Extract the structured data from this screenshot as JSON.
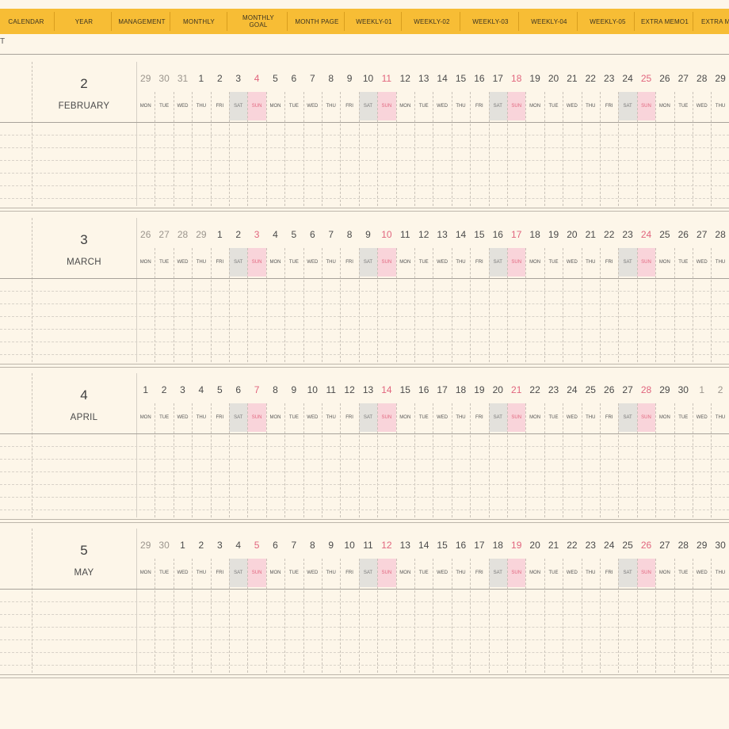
{
  "tabs": [
    {
      "label": "CALENDAR"
    },
    {
      "label": "YEAR"
    },
    {
      "label": "MANAGEMENT"
    },
    {
      "label": "MONTHLY"
    },
    {
      "label": "MONTHLY\nGOAL"
    },
    {
      "label": "MONTH PAGE"
    },
    {
      "label": "WEEKLY-01"
    },
    {
      "label": "WEEKLY-02"
    },
    {
      "label": "WEEKLY-03"
    },
    {
      "label": "WEEKLY-04"
    },
    {
      "label": "WEEKLY-05"
    },
    {
      "label": "EXTRA MEMO1"
    },
    {
      "label": "EXTRA ME"
    }
  ],
  "cut_glyph": "T",
  "colors": {
    "tab_bar": "#f7bd35",
    "background": "#fdf6e9",
    "sunday": "#e1657e",
    "sunday_bg": "#f9d4da",
    "saturday_bg": "#e3e1dc"
  },
  "months": [
    {
      "num": "2",
      "name": "FEBRUARY",
      "days": [
        {
          "n": "29",
          "wd": "MON",
          "t": "other"
        },
        {
          "n": "30",
          "wd": "TUE",
          "t": "other"
        },
        {
          "n": "31",
          "wd": "WED",
          "t": "other"
        },
        {
          "n": "1",
          "wd": "THU"
        },
        {
          "n": "2",
          "wd": "FRI"
        },
        {
          "n": "3",
          "wd": "SAT",
          "t": "sat"
        },
        {
          "n": "4",
          "wd": "SUN",
          "t": "sun"
        },
        {
          "n": "5",
          "wd": "MON"
        },
        {
          "n": "6",
          "wd": "TUE"
        },
        {
          "n": "7",
          "wd": "WED"
        },
        {
          "n": "8",
          "wd": "THU"
        },
        {
          "n": "9",
          "wd": "FRI"
        },
        {
          "n": "10",
          "wd": "SAT",
          "t": "sat"
        },
        {
          "n": "11",
          "wd": "SUN",
          "t": "sun"
        },
        {
          "n": "12",
          "wd": "MON"
        },
        {
          "n": "13",
          "wd": "TUE"
        },
        {
          "n": "14",
          "wd": "WED"
        },
        {
          "n": "15",
          "wd": "THU"
        },
        {
          "n": "16",
          "wd": "FRI"
        },
        {
          "n": "17",
          "wd": "SAT",
          "t": "sat"
        },
        {
          "n": "18",
          "wd": "SUN",
          "t": "sun"
        },
        {
          "n": "19",
          "wd": "MON"
        },
        {
          "n": "20",
          "wd": "TUE"
        },
        {
          "n": "21",
          "wd": "WED"
        },
        {
          "n": "22",
          "wd": "THU"
        },
        {
          "n": "23",
          "wd": "FRI"
        },
        {
          "n": "24",
          "wd": "SAT",
          "t": "sat"
        },
        {
          "n": "25",
          "wd": "SUN",
          "t": "sun"
        },
        {
          "n": "26",
          "wd": "MON"
        },
        {
          "n": "27",
          "wd": "TUE"
        },
        {
          "n": "28",
          "wd": "WED"
        },
        {
          "n": "29",
          "wd": "THU"
        }
      ]
    },
    {
      "num": "3",
      "name": "MARCH",
      "days": [
        {
          "n": "26",
          "wd": "MON",
          "t": "other"
        },
        {
          "n": "27",
          "wd": "TUE",
          "t": "other"
        },
        {
          "n": "28",
          "wd": "WED",
          "t": "other"
        },
        {
          "n": "29",
          "wd": "THU",
          "t": "other"
        },
        {
          "n": "1",
          "wd": "FRI"
        },
        {
          "n": "2",
          "wd": "SAT",
          "t": "sat"
        },
        {
          "n": "3",
          "wd": "SUN",
          "t": "sun"
        },
        {
          "n": "4",
          "wd": "MON"
        },
        {
          "n": "5",
          "wd": "TUE"
        },
        {
          "n": "6",
          "wd": "WED"
        },
        {
          "n": "7",
          "wd": "THU"
        },
        {
          "n": "8",
          "wd": "FRI"
        },
        {
          "n": "9",
          "wd": "SAT",
          "t": "sat"
        },
        {
          "n": "10",
          "wd": "SUN",
          "t": "sun"
        },
        {
          "n": "11",
          "wd": "MON"
        },
        {
          "n": "12",
          "wd": "TUE"
        },
        {
          "n": "13",
          "wd": "WED"
        },
        {
          "n": "14",
          "wd": "THU"
        },
        {
          "n": "15",
          "wd": "FRI"
        },
        {
          "n": "16",
          "wd": "SAT",
          "t": "sat"
        },
        {
          "n": "17",
          "wd": "SUN",
          "t": "sun"
        },
        {
          "n": "18",
          "wd": "MON"
        },
        {
          "n": "19",
          "wd": "TUE"
        },
        {
          "n": "20",
          "wd": "WED"
        },
        {
          "n": "21",
          "wd": "THU"
        },
        {
          "n": "22",
          "wd": "FRI"
        },
        {
          "n": "23",
          "wd": "SAT",
          "t": "sat"
        },
        {
          "n": "24",
          "wd": "SUN",
          "t": "sun"
        },
        {
          "n": "25",
          "wd": "MON"
        },
        {
          "n": "26",
          "wd": "TUE"
        },
        {
          "n": "27",
          "wd": "WED"
        },
        {
          "n": "28",
          "wd": "THU"
        }
      ]
    },
    {
      "num": "4",
      "name": "APRIL",
      "days": [
        {
          "n": "1",
          "wd": "MON"
        },
        {
          "n": "2",
          "wd": "TUE"
        },
        {
          "n": "3",
          "wd": "WED"
        },
        {
          "n": "4",
          "wd": "THU"
        },
        {
          "n": "5",
          "wd": "FRI"
        },
        {
          "n": "6",
          "wd": "SAT",
          "t": "sat"
        },
        {
          "n": "7",
          "wd": "SUN",
          "t": "sun"
        },
        {
          "n": "8",
          "wd": "MON"
        },
        {
          "n": "9",
          "wd": "TUE"
        },
        {
          "n": "10",
          "wd": "WED"
        },
        {
          "n": "11",
          "wd": "THU"
        },
        {
          "n": "12",
          "wd": "FRI"
        },
        {
          "n": "13",
          "wd": "SAT",
          "t": "sat"
        },
        {
          "n": "14",
          "wd": "SUN",
          "t": "sun"
        },
        {
          "n": "15",
          "wd": "MON"
        },
        {
          "n": "16",
          "wd": "TUE"
        },
        {
          "n": "17",
          "wd": "WED"
        },
        {
          "n": "18",
          "wd": "THU"
        },
        {
          "n": "19",
          "wd": "FRI"
        },
        {
          "n": "20",
          "wd": "SAT",
          "t": "sat"
        },
        {
          "n": "21",
          "wd": "SUN",
          "t": "sun"
        },
        {
          "n": "22",
          "wd": "MON"
        },
        {
          "n": "23",
          "wd": "TUE"
        },
        {
          "n": "24",
          "wd": "WED"
        },
        {
          "n": "25",
          "wd": "THU"
        },
        {
          "n": "26",
          "wd": "FRI"
        },
        {
          "n": "27",
          "wd": "SAT",
          "t": "sat"
        },
        {
          "n": "28",
          "wd": "SUN",
          "t": "sun"
        },
        {
          "n": "29",
          "wd": "MON"
        },
        {
          "n": "30",
          "wd": "TUE"
        },
        {
          "n": "1",
          "wd": "WED",
          "t": "other"
        },
        {
          "n": "2",
          "wd": "THU",
          "t": "other"
        }
      ]
    },
    {
      "num": "5",
      "name": "MAY",
      "days": [
        {
          "n": "29",
          "wd": "MON",
          "t": "other"
        },
        {
          "n": "30",
          "wd": "TUE",
          "t": "other"
        },
        {
          "n": "1",
          "wd": "WED"
        },
        {
          "n": "2",
          "wd": "THU"
        },
        {
          "n": "3",
          "wd": "FRI"
        },
        {
          "n": "4",
          "wd": "SAT",
          "t": "sat"
        },
        {
          "n": "5",
          "wd": "SUN",
          "t": "sun"
        },
        {
          "n": "6",
          "wd": "MON"
        },
        {
          "n": "7",
          "wd": "TUE"
        },
        {
          "n": "8",
          "wd": "WED"
        },
        {
          "n": "9",
          "wd": "THU"
        },
        {
          "n": "10",
          "wd": "FRI"
        },
        {
          "n": "11",
          "wd": "SAT",
          "t": "sat"
        },
        {
          "n": "12",
          "wd": "SUN",
          "t": "sun"
        },
        {
          "n": "13",
          "wd": "MON"
        },
        {
          "n": "14",
          "wd": "TUE"
        },
        {
          "n": "15",
          "wd": "WED"
        },
        {
          "n": "16",
          "wd": "THU"
        },
        {
          "n": "17",
          "wd": "FRI"
        },
        {
          "n": "18",
          "wd": "SAT",
          "t": "sat"
        },
        {
          "n": "19",
          "wd": "SUN",
          "t": "sun"
        },
        {
          "n": "20",
          "wd": "MON"
        },
        {
          "n": "21",
          "wd": "TUE"
        },
        {
          "n": "22",
          "wd": "WED"
        },
        {
          "n": "23",
          "wd": "THU"
        },
        {
          "n": "24",
          "wd": "FRI"
        },
        {
          "n": "25",
          "wd": "SAT",
          "t": "sat"
        },
        {
          "n": "26",
          "wd": "SUN",
          "t": "sun"
        },
        {
          "n": "27",
          "wd": "MON"
        },
        {
          "n": "28",
          "wd": "TUE"
        },
        {
          "n": "29",
          "wd": "WED"
        },
        {
          "n": "30",
          "wd": "THU"
        }
      ]
    }
  ]
}
